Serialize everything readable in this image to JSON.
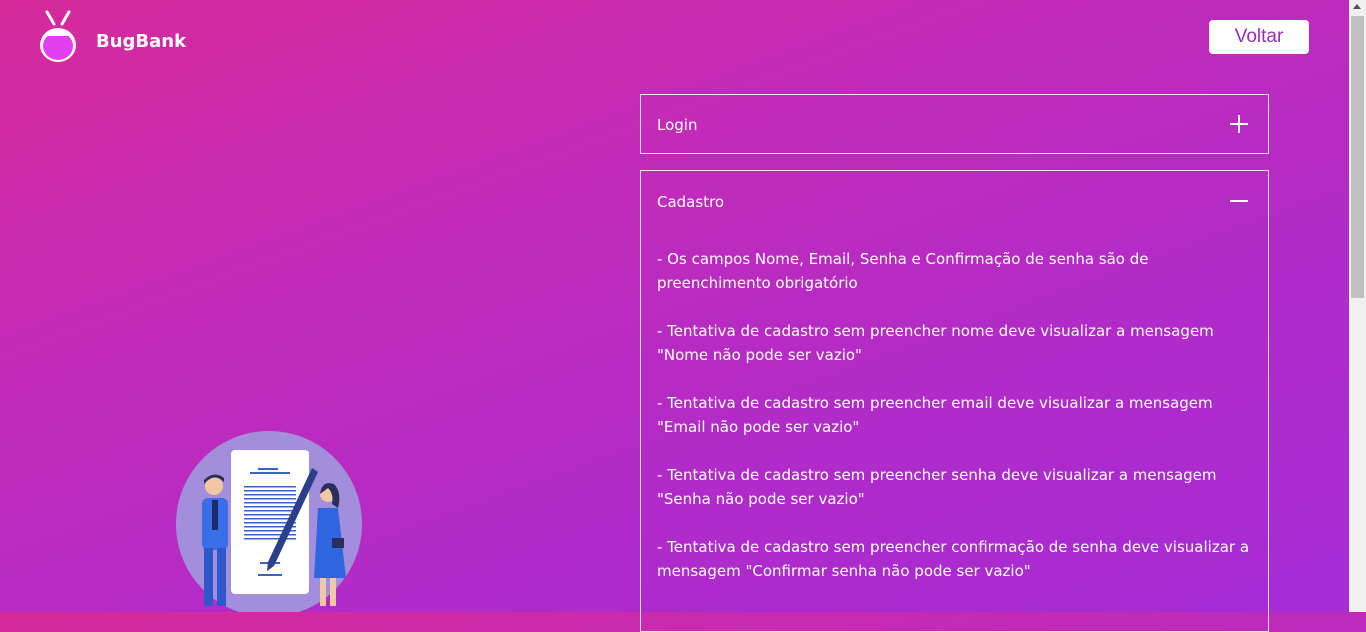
{
  "header": {
    "brand": "BugBank",
    "back_label": "Voltar"
  },
  "accordion": {
    "login_title": "Login",
    "cadastro_title": "Cadastro",
    "cadastro_rules": [
      "- Os campos Nome, Email, Senha e Confirmação de senha são de preenchimento obrigatório",
      "- Tentativa de cadastro sem preencher nome deve visualizar a mensagem \"Nome não pode ser vazio\"",
      "- Tentativa de cadastro sem preencher email deve visualizar a mensagem \"Email não pode ser vazio\"",
      "- Tentativa de cadastro sem preencher senha deve visualizar a mensagem \"Senha não pode ser vazio\"",
      "- Tentativa de cadastro sem preencher confirmação de senha deve visualizar a mensagem \"Confirmar senha não pode ser vazio\""
    ]
  },
  "icons": {
    "logo": "bug-logo-icon",
    "login_toggle": "plus-icon",
    "cadastro_toggle": "minus-icon",
    "illustration": "document-signing-illustration"
  },
  "colors": {
    "background_start": "#d62a9a",
    "background_end": "#a52bd6",
    "button_text": "#9a2bb8",
    "logo_body": "#e23ff2"
  }
}
